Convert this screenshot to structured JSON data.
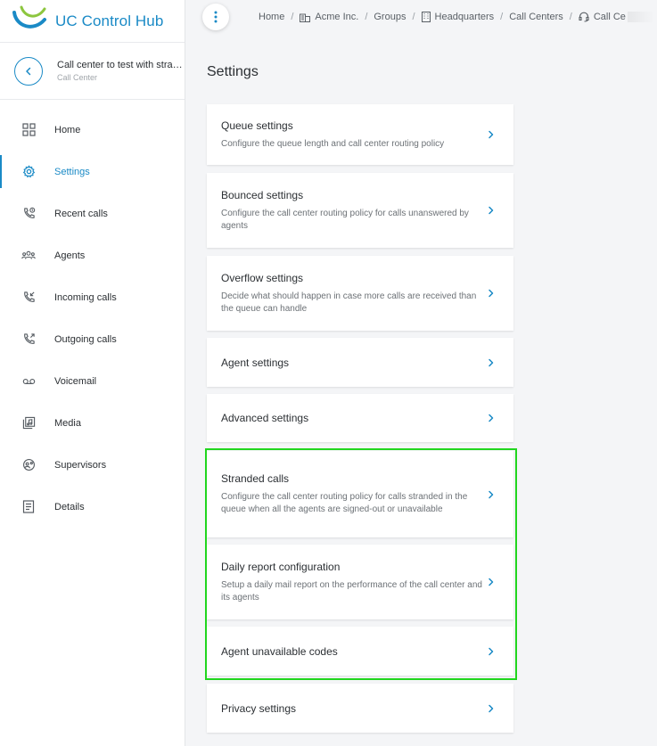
{
  "app": {
    "title": "UC Control Hub",
    "accent": "#1a8ac6"
  },
  "context": {
    "title": "Call center to test with stranded calls",
    "subtitle": "Call Center"
  },
  "nav": [
    {
      "label": "Home",
      "icon": "grid-icon",
      "active": false
    },
    {
      "label": "Settings",
      "icon": "gear-icon",
      "active": true
    },
    {
      "label": "Recent calls",
      "icon": "phone-clock-icon",
      "active": false
    },
    {
      "label": "Agents",
      "icon": "people-icon",
      "active": false
    },
    {
      "label": "Incoming calls",
      "icon": "phone-incoming-icon",
      "active": false
    },
    {
      "label": "Outgoing calls",
      "icon": "phone-outgoing-icon",
      "active": false
    },
    {
      "label": "Voicemail",
      "icon": "voicemail-icon",
      "active": false
    },
    {
      "label": "Media",
      "icon": "media-icon",
      "active": false
    },
    {
      "label": "Supervisors",
      "icon": "supervisor-icon",
      "active": false
    },
    {
      "label": "Details",
      "icon": "document-icon",
      "active": false
    }
  ],
  "breadcrumb": [
    "Home",
    "Acme Inc.",
    "Groups",
    "Headquarters",
    "Call Centers",
    "Call Ce"
  ],
  "page": {
    "title": "Settings"
  },
  "settings": [
    {
      "title": "Queue settings",
      "desc": "Configure the queue length and call center routing policy"
    },
    {
      "title": "Bounced settings",
      "desc": "Configure the call center routing policy for calls unanswered by agents"
    },
    {
      "title": "Overflow settings",
      "desc": "Decide what should happen in case more calls are received than the queue can handle"
    },
    {
      "title": "Agent settings",
      "desc": ""
    },
    {
      "title": "Advanced settings",
      "desc": ""
    },
    {
      "title": "Stranded calls",
      "desc": "Configure the call center routing policy for calls stranded in the queue when all the agents are signed-out or unavailable"
    },
    {
      "title": "Daily report configuration",
      "desc": "Setup a daily mail report on the performance of the call center and its agents"
    },
    {
      "title": "Agent unavailable codes",
      "desc": ""
    },
    {
      "title": "Privacy settings",
      "desc": ""
    }
  ],
  "highlight_color": "#21d61e"
}
